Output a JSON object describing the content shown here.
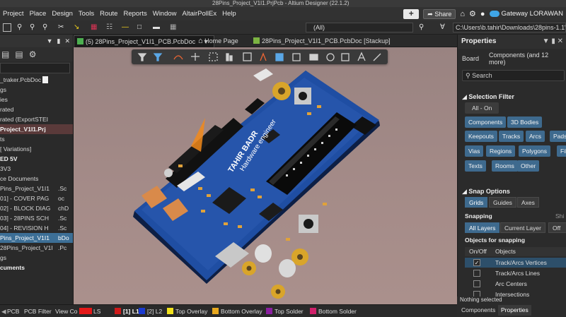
{
  "window": {
    "title": "28Pins_Project_V1I1.PrjPcb - Altium Designer (22.1.2)"
  },
  "menu": {
    "items": [
      "Project",
      "Place",
      "Design",
      "Tools",
      "Route",
      "Reports",
      "Window",
      "AltairPollEx",
      "Help"
    ],
    "share_label": "Share",
    "workspace": "Gateway LORAWAN"
  },
  "toolbar": {
    "filter_value": "(All)",
    "path": "C:\\Users\\b.tahir\\Downloads\\28pins-1.1\\28"
  },
  "left_panel": {
    "items": [
      {
        "text": "_traker.PcbDoc",
        "ext": "",
        "style": "normal",
        "page_icon": true
      },
      {
        "text": "gs",
        "ext": "",
        "style": "normal"
      },
      {
        "text": "ies",
        "ext": "",
        "style": "normal"
      },
      {
        "text": "rated",
        "ext": "",
        "style": "normal"
      },
      {
        "text": "rated (ExportSTEI",
        "ext": "",
        "style": "normal"
      },
      {
        "text": "Project_V1I1.Prj",
        "ext": "",
        "style": "highlight"
      },
      {
        "text": "ts",
        "ext": "",
        "style": "normal"
      },
      {
        "text": "[ Variations]",
        "ext": "",
        "style": "normal"
      },
      {
        "text": "ED 5V",
        "ext": "",
        "style": "bold"
      },
      {
        "text": "3V3",
        "ext": "",
        "style": "normal"
      },
      {
        "text": "ce Documents",
        "ext": "",
        "style": "normal"
      },
      {
        "text": "Pins_Project_V1I1",
        "ext": ".Sc",
        "style": "normal"
      },
      {
        "text": "01] - COVER PAG",
        "ext": "oc",
        "style": "normal"
      },
      {
        "text": "02] - BLOCK DIAG",
        "ext": "chD",
        "style": "normal"
      },
      {
        "text": "03] - 28PINS SCH",
        "ext": ".Sc",
        "style": "normal"
      },
      {
        "text": "04] - REVISION H",
        "ext": ".Sc",
        "style": "normal"
      },
      {
        "text": "Pins_Project_V1I1",
        "ext": "bDo",
        "style": "selected"
      },
      {
        "text": "28Pins_Project_V1I",
        "ext": ".Pc",
        "style": "normal"
      },
      {
        "text": "gs",
        "ext": "",
        "style": "normal"
      },
      {
        "text": "cuments",
        "ext": "",
        "style": "bold"
      }
    ]
  },
  "tabs": [
    {
      "label": "(5) 28Pins_Project_V1I1_PCB.PcbDoc",
      "active": true
    },
    {
      "label": "Home Page",
      "active": false
    },
    {
      "label": "28Pins_Project_V1I1_PCB.PcbDoc [Stackup]",
      "active": false
    }
  ],
  "board": {
    "silk_name": "TAHIR BADR",
    "silk_title": "Hardware engineer"
  },
  "properties": {
    "title": "Properties",
    "scope_left": "Board",
    "scope_right": "Components (and 12 more)",
    "search_placeholder": "Search",
    "selection_filter": {
      "title": "Selection Filter",
      "all_on": "All - On",
      "chips": [
        "Components",
        "3D Bodies",
        "Keepouts",
        "Tracks",
        "Arcs",
        "Pads",
        "Vias",
        "Regions",
        "Polygons",
        "Fills",
        "Texts",
        "Rooms",
        "Other"
      ]
    },
    "snap_options": {
      "title": "Snap Options",
      "modes": [
        "Grids",
        "Guides",
        "Axes"
      ],
      "snapping_label": "Snapping",
      "snapping_hint": "Shi",
      "layer_modes": [
        "All Layers",
        "Current Layer",
        "Off"
      ],
      "objects_label": "Objects for snapping",
      "col_onoff": "On/Off",
      "col_objects": "Objects",
      "objects": [
        {
          "label": "Track/Arcs Vertices",
          "checked": true
        },
        {
          "label": "Track/Arcs Lines",
          "checked": false
        },
        {
          "label": "Arc Centers",
          "checked": false
        },
        {
          "label": "Intersections",
          "checked": false
        }
      ]
    },
    "status": "Nothing selected",
    "bottom_tabs": [
      "Components",
      "Properties"
    ]
  },
  "status_bar": {
    "items": [
      {
        "label": "PCB",
        "color": ""
      },
      {
        "label": "PCB Filter",
        "color": ""
      },
      {
        "label": "View Co",
        "color": ""
      },
      {
        "label": "LS",
        "color": "#e51919"
      },
      {
        "label": "[1] L1",
        "color": "#d01a1a"
      },
      {
        "label": "[2] L2",
        "color": "#1a3ad0"
      },
      {
        "label": "Top Overlay",
        "color": "#f2e21c"
      },
      {
        "label": "Bottom Overlay",
        "color": "#e8a81e"
      },
      {
        "label": "Top Solder",
        "color": "#8a1fa0"
      },
      {
        "label": "Bottom Solder",
        "color": "#d0206a"
      }
    ]
  }
}
